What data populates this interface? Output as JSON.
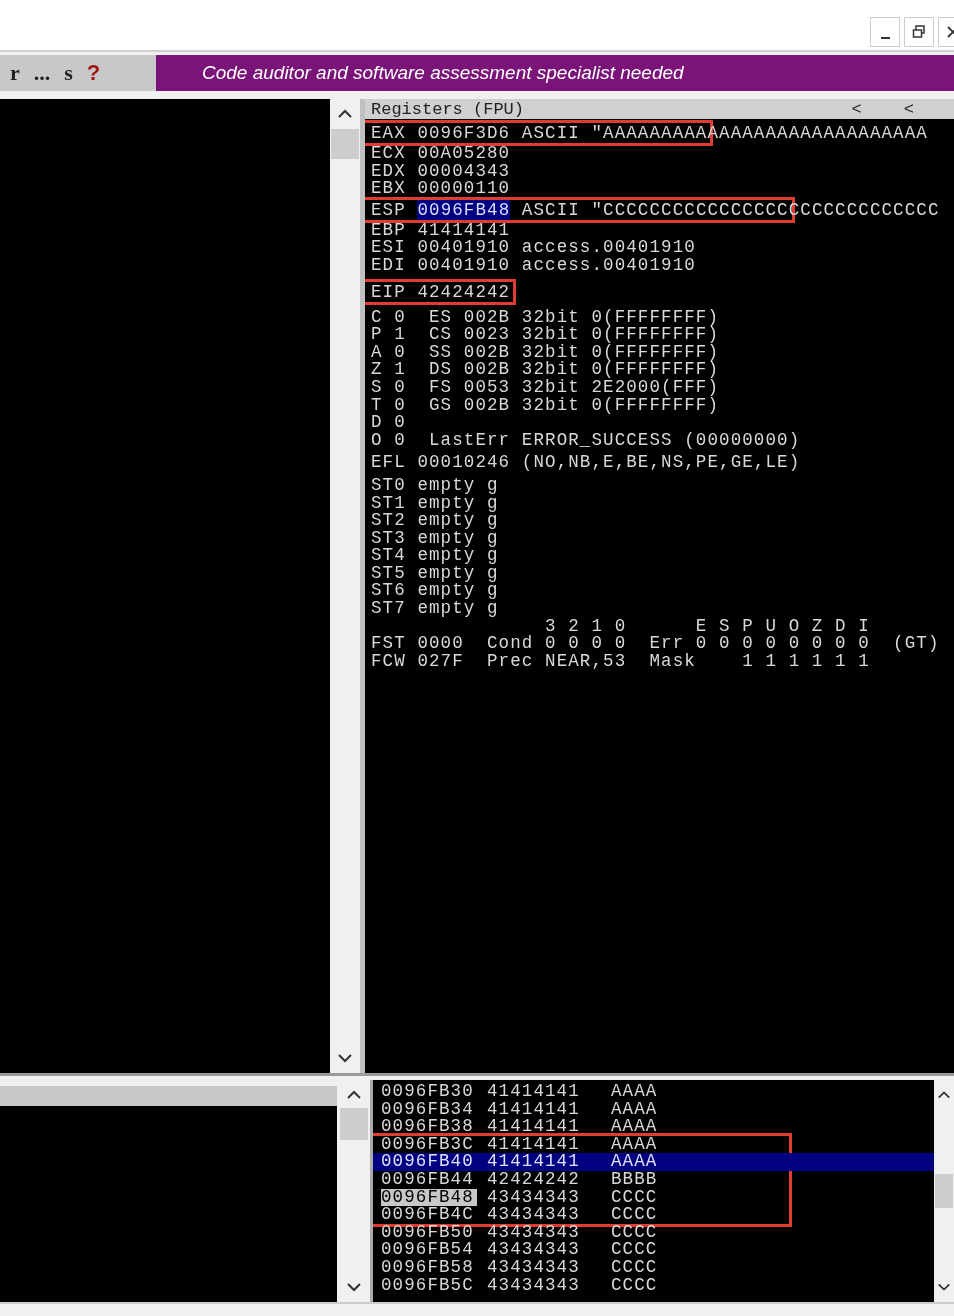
{
  "toolbar": {
    "buttons": [
      {
        "label": "r",
        "kind": "plain"
      },
      {
        "label": "...",
        "kind": "plain"
      },
      {
        "label": "s",
        "kind": "plain"
      },
      {
        "label": "?",
        "kind": "help"
      }
    ],
    "banner": "Code auditor and software assessment specialist needed"
  },
  "registers": {
    "title": "Registers (FPU)",
    "header_buttons": [
      "<",
      "<"
    ],
    "groups": [
      {
        "lines": [
          {
            "segments": [
              {
                "text": "EAX 0096F3D6 ASCII \"AAAAAAAAA",
                "selected": false,
                "boxed": true
              },
              {
                "text": "AAAAAAAAAAAAAAAAAAA",
                "selected": false,
                "boxed": false
              }
            ]
          },
          {
            "segments": [
              {
                "text": "ECX 00A05280",
                "selected": false,
                "boxed": false
              }
            ]
          },
          {
            "segments": [
              {
                "text": "EDX 00004343",
                "selected": false,
                "boxed": false
              }
            ]
          },
          {
            "segments": [
              {
                "text": "EBX 00000110",
                "selected": false,
                "boxed": false
              }
            ]
          },
          {
            "segments": [
              {
                "text": "ESP ",
                "selected": false,
                "boxed": true
              },
              {
                "text": "0096FB48",
                "selected": true,
                "boxed": true
              },
              {
                "text": " ASCII \"CCCCCCCCCCCCCCCC",
                "selected": false,
                "boxed": true
              },
              {
                "text": "CCCCCCCCCCCCC",
                "selected": false,
                "boxed": false
              }
            ]
          },
          {
            "segments": [
              {
                "text": "EBP 41414141",
                "selected": false,
                "boxed": false
              }
            ]
          },
          {
            "segments": [
              {
                "text": "ESI 00401910 access.00401910",
                "selected": false,
                "boxed": false
              }
            ]
          },
          {
            "segments": [
              {
                "text": "EDI 00401910 access.00401910",
                "selected": false,
                "boxed": false
              }
            ]
          }
        ]
      },
      {
        "lines": [
          {
            "segments": [
              {
                "text": "EIP 42424242",
                "selected": false,
                "boxed": true
              }
            ]
          }
        ]
      },
      {
        "lines": [
          {
            "segments": [
              {
                "text": "C 0  ES 002B 32bit 0(FFFFFFFF)",
                "selected": false,
                "boxed": false
              }
            ]
          },
          {
            "segments": [
              {
                "text": "P 1  CS 0023 32bit 0(FFFFFFFF)",
                "selected": false,
                "boxed": false
              }
            ]
          },
          {
            "segments": [
              {
                "text": "A 0  SS 002B 32bit 0(FFFFFFFF)",
                "selected": false,
                "boxed": false
              }
            ]
          },
          {
            "segments": [
              {
                "text": "Z 1  DS 002B 32bit 0(FFFFFFFF)",
                "selected": false,
                "boxed": false
              }
            ]
          },
          {
            "segments": [
              {
                "text": "S 0  FS 0053 32bit 2E2000(FFF)",
                "selected": false,
                "boxed": false
              }
            ]
          },
          {
            "segments": [
              {
                "text": "T 0  GS 002B 32bit 0(FFFFFFFF)",
                "selected": false,
                "boxed": false
              }
            ]
          },
          {
            "segments": [
              {
                "text": "D 0",
                "selected": false,
                "boxed": false
              }
            ]
          },
          {
            "segments": [
              {
                "text": "O 0  LastErr ERROR_SUCCESS (00000000)",
                "selected": false,
                "boxed": false
              }
            ]
          }
        ]
      },
      {
        "lines": [
          {
            "segments": [
              {
                "text": "EFL 00010246 (NO,NB,E,BE,NS,PE,GE,LE)",
                "selected": false,
                "boxed": false
              }
            ]
          }
        ]
      },
      {
        "lines": [
          {
            "segments": [
              {
                "text": "ST0 empty g",
                "selected": false,
                "boxed": false
              }
            ]
          },
          {
            "segments": [
              {
                "text": "ST1 empty g",
                "selected": false,
                "boxed": false
              }
            ]
          },
          {
            "segments": [
              {
                "text": "ST2 empty g",
                "selected": false,
                "boxed": false
              }
            ]
          },
          {
            "segments": [
              {
                "text": "ST3 empty g",
                "selected": false,
                "boxed": false
              }
            ]
          },
          {
            "segments": [
              {
                "text": "ST4 empty g",
                "selected": false,
                "boxed": false
              }
            ]
          },
          {
            "segments": [
              {
                "text": "ST5 empty g",
                "selected": false,
                "boxed": false
              }
            ]
          },
          {
            "segments": [
              {
                "text": "ST6 empty g",
                "selected": false,
                "boxed": false
              }
            ]
          },
          {
            "segments": [
              {
                "text": "ST7 empty g",
                "selected": false,
                "boxed": false
              }
            ]
          },
          {
            "segments": [
              {
                "text": "               3 2 1 0      E S P U O Z D I",
                "selected": false,
                "boxed": false
              }
            ]
          },
          {
            "segments": [
              {
                "text": "FST 0000  Cond 0 0 0 0  Err 0 0 0 0 0 0 0 0  (GT)",
                "selected": false,
                "boxed": false
              }
            ]
          },
          {
            "segments": [
              {
                "text": "FCW 027F  Prec NEAR,53  Mask    1 1 1 1 1 1",
                "selected": false,
                "boxed": false
              }
            ]
          }
        ]
      }
    ]
  },
  "stack": {
    "blocks": [
      {
        "boxed": false,
        "rows": [
          {
            "address": "0096FB30",
            "value": "41414141",
            "ascii": "AAAA",
            "selected": false,
            "marked": false
          },
          {
            "address": "0096FB34",
            "value": "41414141",
            "ascii": "AAAA",
            "selected": false,
            "marked": false
          },
          {
            "address": "0096FB38",
            "value": "41414141",
            "ascii": "AAAA",
            "selected": false,
            "marked": false
          }
        ]
      },
      {
        "boxed": true,
        "rows": [
          {
            "address": "0096FB3C",
            "value": "41414141",
            "ascii": "AAAA",
            "selected": false,
            "marked": false
          },
          {
            "address": "0096FB40",
            "value": "41414141",
            "ascii": "AAAA",
            "selected": true,
            "marked": false
          },
          {
            "address": "0096FB44",
            "value": "42424242",
            "ascii": "BBBB",
            "selected": false,
            "marked": false
          },
          {
            "address": "0096FB48",
            "value": "43434343",
            "ascii": "CCCC",
            "selected": false,
            "marked": true
          },
          {
            "address": "0096FB4C",
            "value": "43434343",
            "ascii": "CCCC",
            "selected": false,
            "marked": false
          }
        ]
      },
      {
        "boxed": false,
        "rows": [
          {
            "address": "0096FB50",
            "value": "43434343",
            "ascii": "CCCC",
            "selected": false,
            "marked": false
          },
          {
            "address": "0096FB54",
            "value": "43434343",
            "ascii": "CCCC",
            "selected": false,
            "marked": false
          },
          {
            "address": "0096FB58",
            "value": "43434343",
            "ascii": "CCCC",
            "selected": false,
            "marked": false
          },
          {
            "address": "0096FB5C",
            "value": "43434343",
            "ascii": "CCCC",
            "selected": false,
            "marked": false
          }
        ]
      }
    ]
  }
}
